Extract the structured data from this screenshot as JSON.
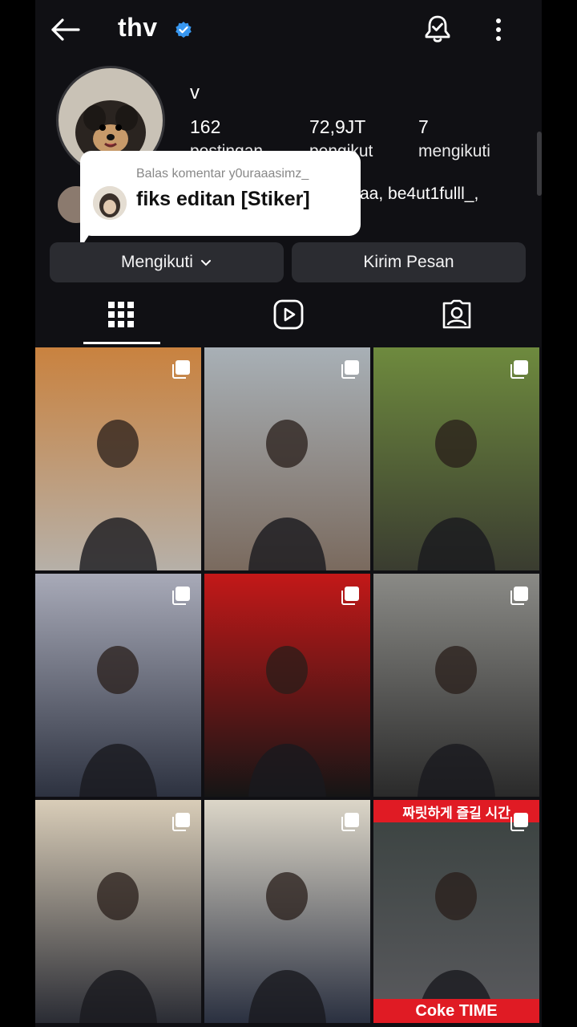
{
  "header": {
    "username": "thv",
    "verified_icon": "verified-badge-icon",
    "back_icon": "arrow-left-icon",
    "bell_icon": "bell-check-icon",
    "more_icon": "more-vertical-icon"
  },
  "profile": {
    "name": "v",
    "stats": [
      {
        "value": "162",
        "label": "postingan"
      },
      {
        "value": "72,9JT",
        "label": "pengikut"
      },
      {
        "value": "7",
        "label": "mengikuti"
      }
    ],
    "followed_by_text": "aa, be4ut1fulll_,"
  },
  "buttons": {
    "following": "Mengikuti",
    "message": "Kirim Pesan"
  },
  "tabs": [
    {
      "name": "grid",
      "icon": "grid-icon",
      "active": true
    },
    {
      "name": "reels",
      "icon": "reels-play-icon",
      "active": false
    },
    {
      "name": "tagged",
      "icon": "tagged-person-icon",
      "active": false
    }
  ],
  "sticker": {
    "reply_to": "Balas komentar y0uraaasimz_",
    "text": "fiks editan [Stiker]"
  },
  "posts": [
    {
      "kind": "photo",
      "multi": true,
      "colors": [
        "#c9823f",
        "#b6b0a8"
      ]
    },
    {
      "kind": "photo",
      "multi": true,
      "colors": [
        "#a8b0b6",
        "#7a6a5e"
      ]
    },
    {
      "kind": "photo",
      "multi": true,
      "colors": [
        "#6e8a3e",
        "#3a3c30"
      ]
    },
    {
      "kind": "photo",
      "multi": true,
      "colors": [
        "#a8aab8",
        "#2d3240"
      ]
    },
    {
      "kind": "photo",
      "multi": true,
      "colors": [
        "#c31818",
        "#151515"
      ]
    },
    {
      "kind": "photo",
      "multi": true,
      "colors": [
        "#8a8a86",
        "#2a2a2a"
      ]
    },
    {
      "kind": "photo",
      "multi": true,
      "colors": [
        "#d9cdb8",
        "#2a2c34"
      ]
    },
    {
      "kind": "photo",
      "multi": true,
      "colors": [
        "#dcd6c8",
        "#2a3040"
      ]
    },
    {
      "kind": "photo",
      "multi": true,
      "colors": [
        "#3a4240",
        "#5a5a5e"
      ],
      "banner_top": "짜릿하게 즐길 시간",
      "banner_bottom": "Coke TIME",
      "banner_color": "#e01b24"
    }
  ]
}
